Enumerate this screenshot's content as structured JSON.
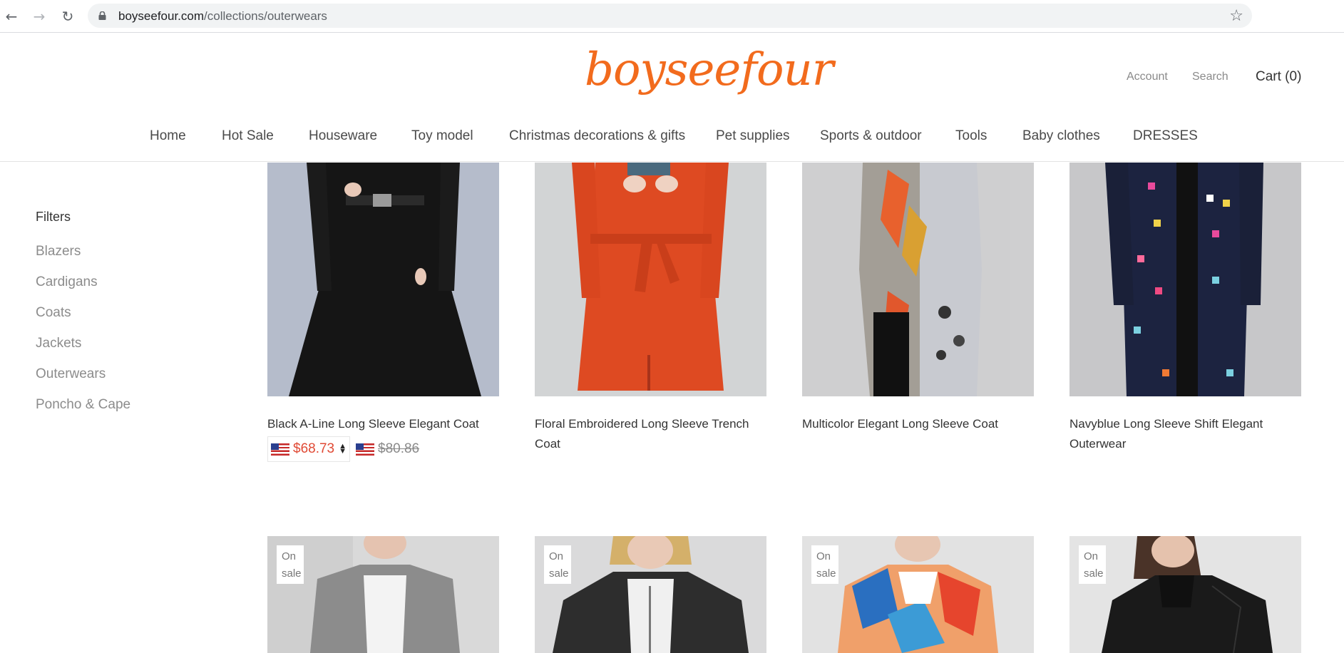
{
  "browser": {
    "url_domain": "boyseefour.com",
    "url_path": "/collections/outerwears"
  },
  "header": {
    "logo": "boyseefour",
    "account": "Account",
    "search": "Search",
    "cart": "Cart (0)"
  },
  "nav": {
    "items": [
      "Home",
      "Hot Sale",
      "Houseware",
      "Toy model",
      "Christmas decorations & gifts",
      "Pet supplies",
      "Sports & outdoor",
      "Tools",
      "Baby clothes",
      "DRESSES"
    ]
  },
  "sidebar": {
    "title": "Filters",
    "items": [
      "Blazers",
      "Cardigans",
      "Coats",
      "Jackets",
      "Outerwears",
      "Poncho & Cape"
    ]
  },
  "products": [
    {
      "title": "Black A-Line Long Sleeve Elegant Coat",
      "price": "$68.73",
      "compare_price": "$80.86"
    },
    {
      "title": "Floral Embroidered Long Sleeve Trench Coat"
    },
    {
      "title": "Multicolor Elegant Long Sleeve Coat"
    },
    {
      "title": "Navyblue Long Sleeve Shift Elegant Outerwear"
    }
  ],
  "next_row": {
    "badge": "On sale"
  },
  "colors": {
    "brand": "#f26b1d",
    "sale_price": "#e04a35"
  }
}
